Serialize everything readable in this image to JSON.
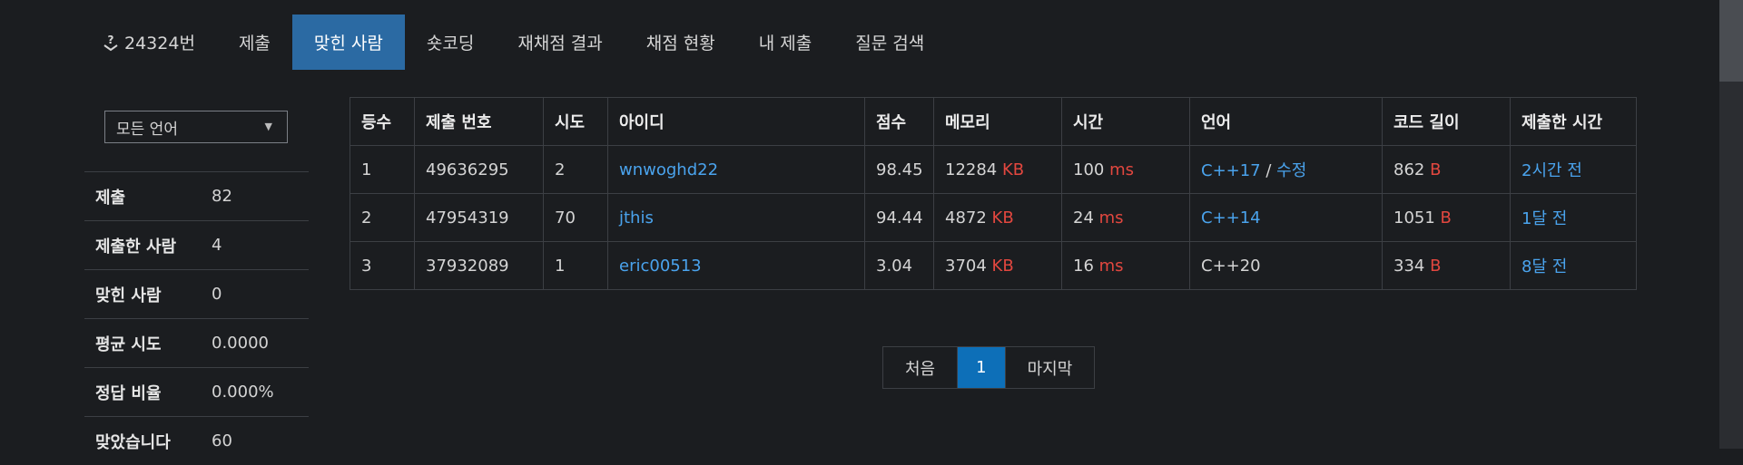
{
  "nav": {
    "problem_label": "24324번",
    "tabs": [
      "제출",
      "맞힌 사람",
      "숏코딩",
      "재채점 결과",
      "채점 현황",
      "내 제출",
      "질문 검색"
    ],
    "active_tab": "맞힌 사람"
  },
  "filter": {
    "language_selected": "모든 언어"
  },
  "stats": [
    {
      "label": "제출",
      "value": "82",
      "link": true
    },
    {
      "label": "제출한 사람",
      "value": "4",
      "link": false
    },
    {
      "label": "맞힌 사람",
      "value": "0",
      "link": false
    },
    {
      "label": "평균 시도",
      "value": "0.0000",
      "link": false
    },
    {
      "label": "정답 비율",
      "value": "0.000%",
      "link": false
    },
    {
      "label": "맞았습니다",
      "value": "60",
      "link": true
    }
  ],
  "table": {
    "headers": [
      "등수",
      "제출 번호",
      "시도",
      "아이디",
      "점수",
      "메모리",
      "시간",
      "언어",
      "코드 길이",
      "제출한 시간"
    ],
    "units": {
      "memory": "KB",
      "time": "ms",
      "code": "B"
    },
    "edit_label": "수정",
    "rows": [
      {
        "rank": "1",
        "submission": "49636295",
        "attempts": "2",
        "user": "wnwoghd22",
        "score": "98.45",
        "memory": "12284",
        "time": "100",
        "language": "C++17",
        "language_link": true,
        "editable": true,
        "code_length": "862",
        "submitted": "2시간 전"
      },
      {
        "rank": "2",
        "submission": "47954319",
        "attempts": "70",
        "user": "jthis",
        "score": "94.44",
        "memory": "4872",
        "time": "24",
        "language": "C++14",
        "language_link": true,
        "editable": false,
        "code_length": "1051",
        "submitted": "1달 전"
      },
      {
        "rank": "3",
        "submission": "37932089",
        "attempts": "1",
        "user": "eric00513",
        "score": "3.04",
        "memory": "3704",
        "time": "16",
        "language": "C++20",
        "language_link": false,
        "editable": false,
        "code_length": "334",
        "submitted": "8달 전"
      }
    ]
  },
  "pagination": {
    "first": "처음",
    "current": "1",
    "last": "마지막"
  },
  "colors": {
    "link": "#4aa3ed",
    "unit": "#e2473f",
    "active_tab": "#2b6aa3",
    "active_page": "#0d6fb8"
  },
  "icons": {
    "problem": "question-badge-icon",
    "select_arrow": "caret-down-icon"
  }
}
